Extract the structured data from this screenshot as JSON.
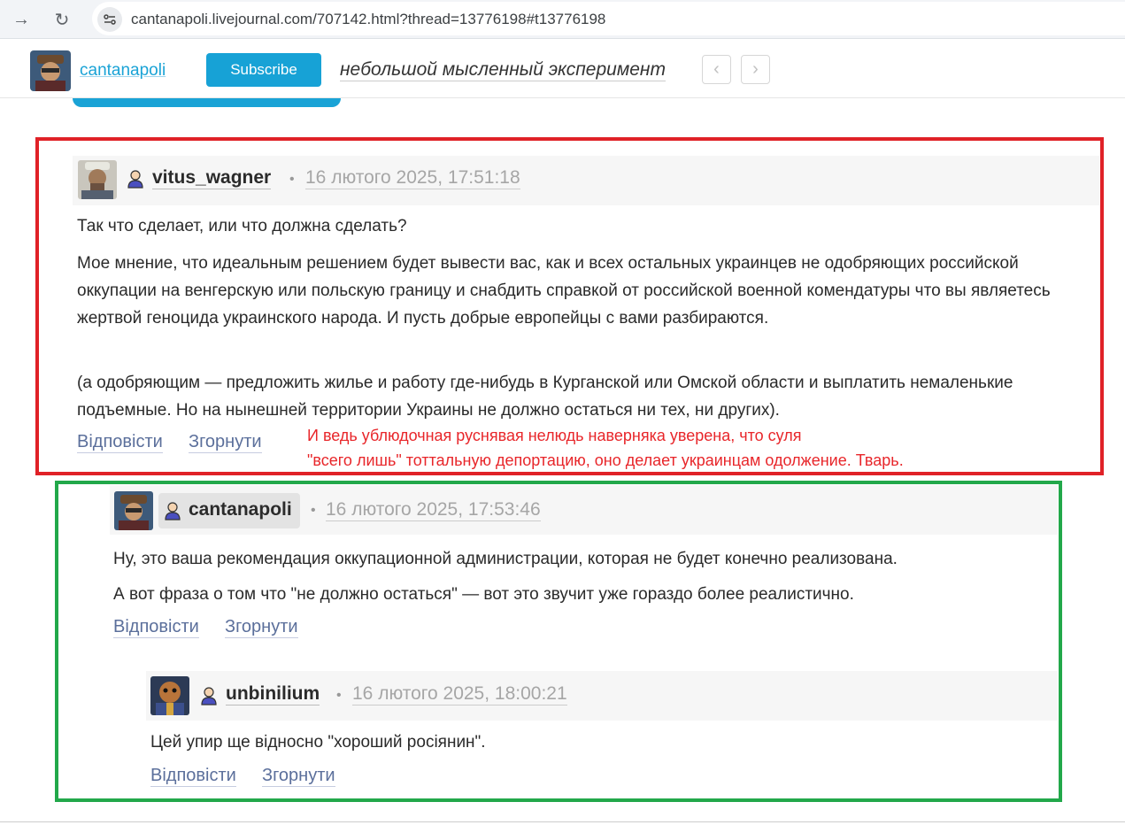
{
  "browser": {
    "url": "cantanapoli.livejournal.com/707142.html?thread=13776198#t13776198"
  },
  "header": {
    "journal_user": "cantanapoli",
    "subscribe_label": "Subscribe",
    "post_title": "небольшой мысленный эксперимент"
  },
  "comments": [
    {
      "user": "vitus_wagner",
      "date": "16 лютого 2025, 17:51:18",
      "paragraphs": [
        "Так что сделает, или что должна сделать?",
        "Мое мнение, что идеальным решением будет вывести вас, как и всех остальных украинцев не одобряющих российской оккупации на венгерскую или польскую границу и снабдить справкой от российской военной комендатуры что вы являетесь жертвой геноцида украинского народа. И пусть добрые европейцы с вами разбираются.",
        "(а одобряющим — предложить жилье и работу где-нибудь в Курганской или Омской области и выплатить немаленькие подъемные. Но на нынешней территории Украины не должно остаться ни тех, ни других)."
      ],
      "reply_label": "Відповісти",
      "collapse_label": "Згорнути"
    },
    {
      "user": "cantanapoli",
      "date": "16 лютого 2025, 17:53:46",
      "paragraphs": [
        "Ну, это ваша рекомендация оккупационной администрации, которая не будет конечно реализована.",
        "А вот фраза о том что \"не должно остаться\" — вот это звучит уже гораздо более реалистично."
      ],
      "reply_label": "Відповісти",
      "collapse_label": "Згорнути"
    },
    {
      "user": "unbinilium",
      "date": "16 лютого 2025, 18:00:21",
      "paragraphs": [
        "Цей упир ще відносно \"хороший росіянин\"."
      ],
      "reply_label": "Відповісти",
      "collapse_label": "Згорнути"
    }
  ],
  "annotation": {
    "line1": "И ведь ублюдочная руснявая нелюдь наверняка уверена, что суля",
    "line2": "\"всего лишь\" тоттальную депортацию, оно делает украинцам одолжение. Тварь."
  },
  "colors": {
    "red_outline": "#e02127",
    "green_outline": "#22a84a",
    "subscribe_bg": "#17a2d6",
    "link_blue": "#5b6f9b",
    "annotation_red": "#e8262a"
  }
}
